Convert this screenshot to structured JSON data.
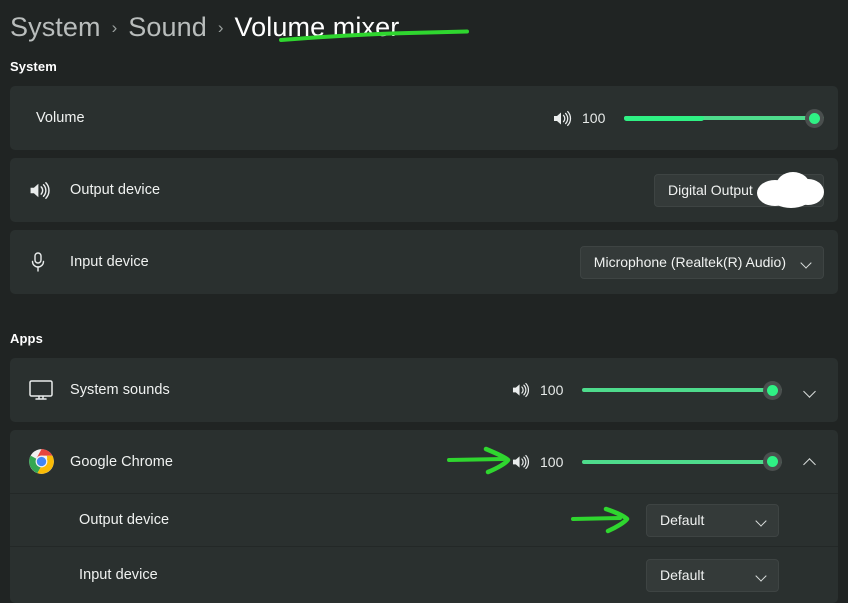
{
  "breadcrumb": {
    "items": [
      {
        "label": "System",
        "current": false
      },
      {
        "label": "Sound",
        "current": false
      },
      {
        "label": "Volume mixer",
        "current": true
      }
    ],
    "separator": "›"
  },
  "sections": {
    "system": {
      "title": "System",
      "volume_row": {
        "label": "Volume",
        "speaker_icon": "speaker-wave-icon",
        "value": "100",
        "level_percent": 40
      },
      "output_row": {
        "label": "Output device",
        "icon": "speaker-wave-icon",
        "dropdown_value": "Digital Output",
        "redacted": true
      },
      "input_row": {
        "label": "Input device",
        "icon": "microphone-icon",
        "dropdown_value": "Microphone (Realtek(R) Audio)"
      }
    },
    "apps": {
      "title": "Apps",
      "items": [
        {
          "label": "System sounds",
          "icon": "monitor-icon",
          "speaker_icon": "speaker-wave-icon",
          "value": "100",
          "expanded": false
        },
        {
          "label": "Google Chrome",
          "icon": "chrome-icon",
          "speaker_icon": "speaker-wave-icon",
          "value": "100",
          "expanded": true,
          "sub_rows": [
            {
              "label": "Output device",
              "dropdown_value": "Default"
            },
            {
              "label": "Input device",
              "dropdown_value": "Default"
            }
          ]
        }
      ]
    }
  },
  "annotations": {
    "underline_color": "#2fd62f",
    "arrow_color": "#2fd62f",
    "arrow_targets": [
      "chrome-volume-slider",
      "chrome-output-device-dropdown"
    ]
  },
  "colors": {
    "page_background": "#202423",
    "card_background": "#2a302f",
    "slider_green": "#4edb8c",
    "slider_meter_green": "#2ff184",
    "accent_annotation": "#2fd62f"
  }
}
